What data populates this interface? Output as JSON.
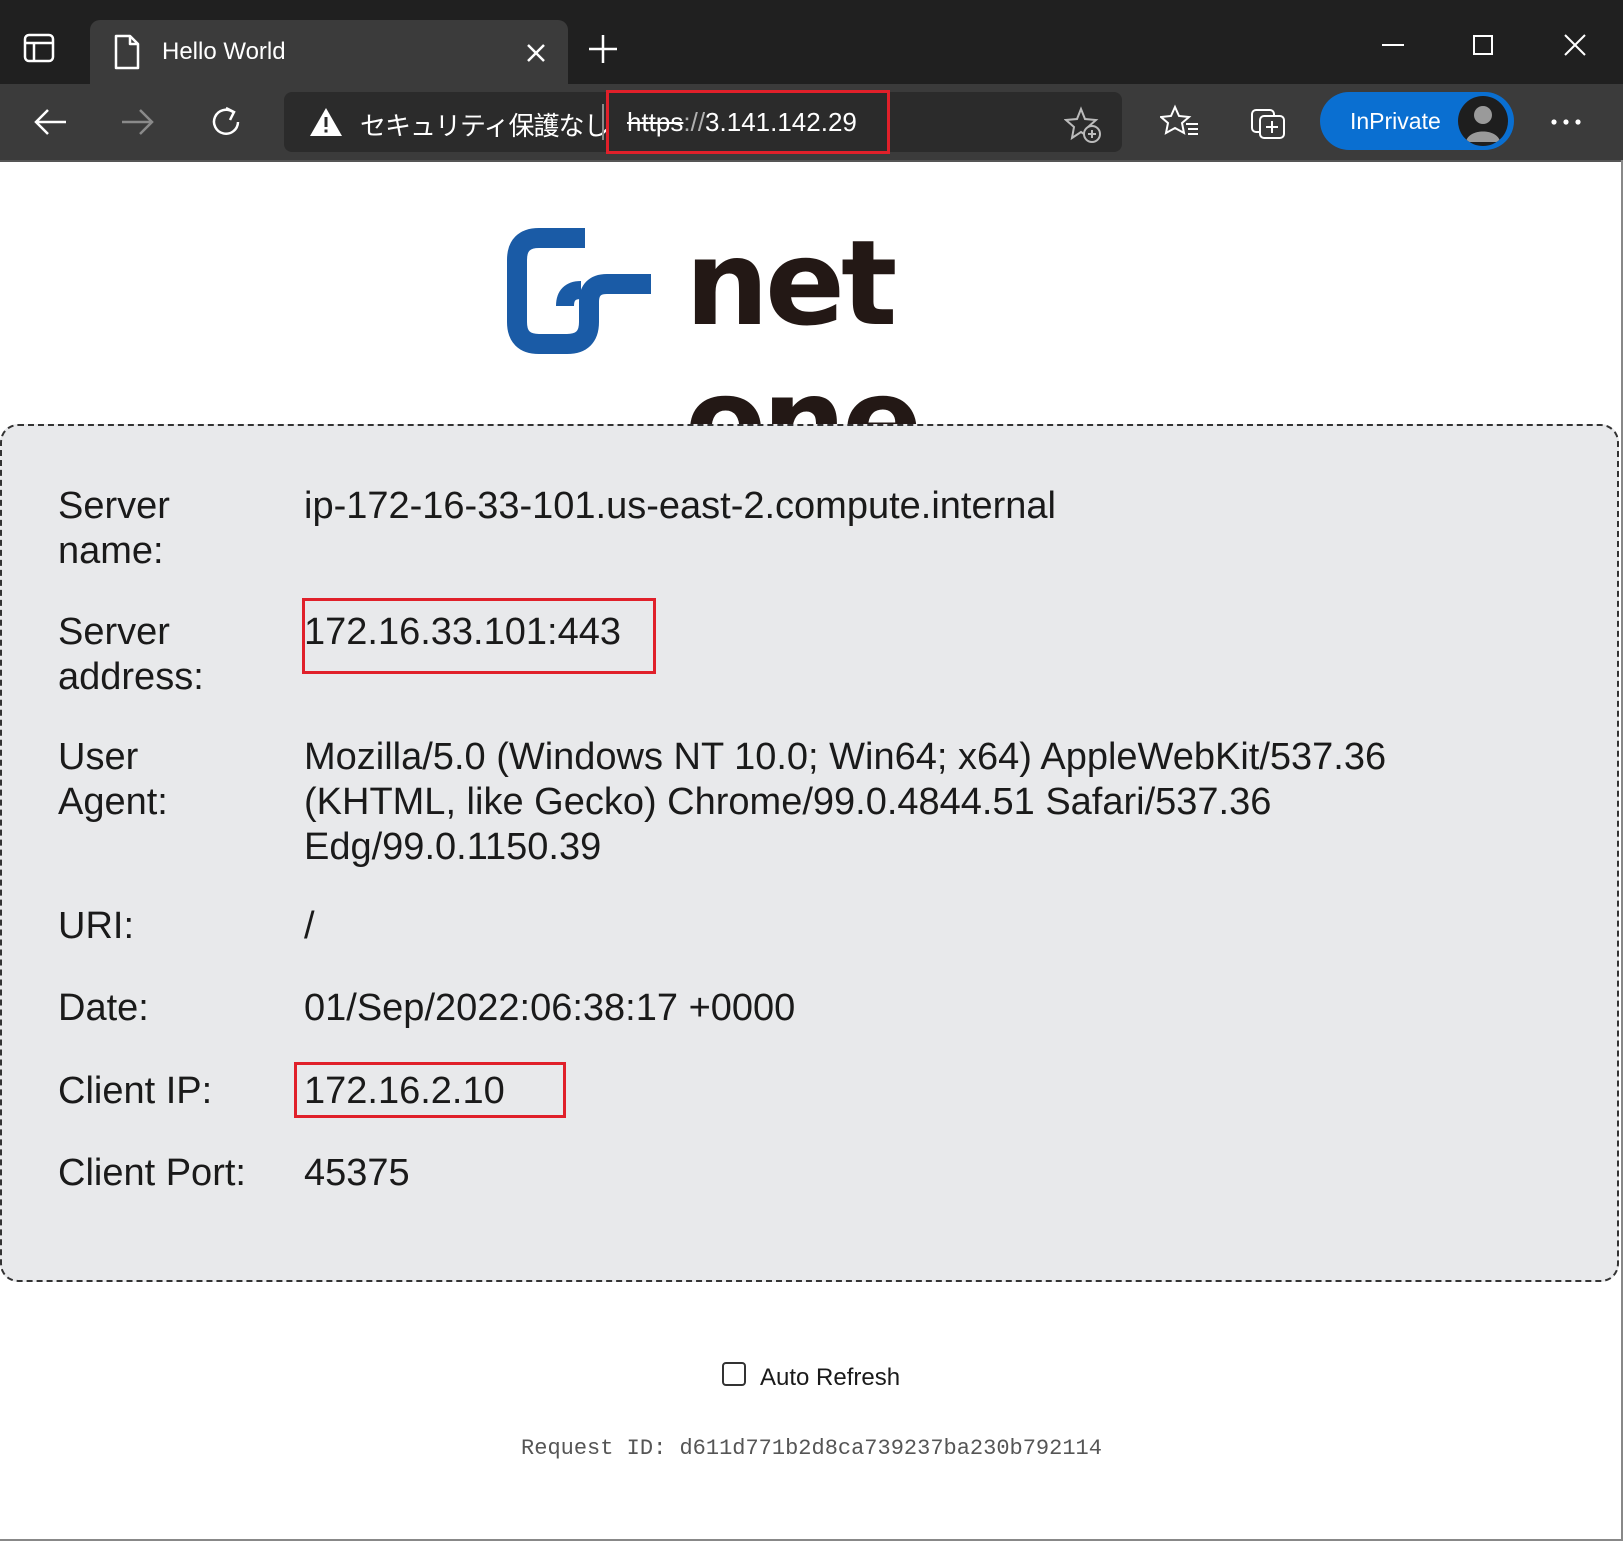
{
  "browser": {
    "tab": {
      "title": "Hello World"
    },
    "address_bar": {
      "security_text": "セキュリティ保護なし",
      "url_scheme": "https",
      "url_slashes": "://",
      "url_host": "3.141.142.29"
    },
    "inprivate_label": "InPrivate",
    "colors": {
      "inprivate": "#0a6fd1",
      "highlight": "#e0202a"
    }
  },
  "logo": {
    "text": "net one",
    "mark_color": "#1a5ba6",
    "text_color": "#231815"
  },
  "info": {
    "rows": [
      {
        "label": "Server name:",
        "value": "ip-172-16-33-101.us-east-2.compute.internal"
      },
      {
        "label": "Server address:",
        "value": "172.16.33.101:443"
      },
      {
        "label": "User Agent:",
        "value": "Mozilla/5.0 (Windows NT 10.0; Win64; x64) AppleWebKit/537.36 (KHTML, like Gecko) Chrome/99.0.4844.51 Safari/537.36 Edg/99.0.1150.39"
      },
      {
        "label": "URI:",
        "value": "/"
      },
      {
        "label": "Date:",
        "value": "01/Sep/2022:06:38:17 +0000"
      },
      {
        "label": "Client IP:",
        "value": "172.16.2.10"
      },
      {
        "label": "Client Port:",
        "value": "45375"
      }
    ]
  },
  "auto_refresh": {
    "label": "Auto Refresh",
    "checked": false
  },
  "request_id": "Request ID: d611d771b2d8ca739237ba230b792114"
}
